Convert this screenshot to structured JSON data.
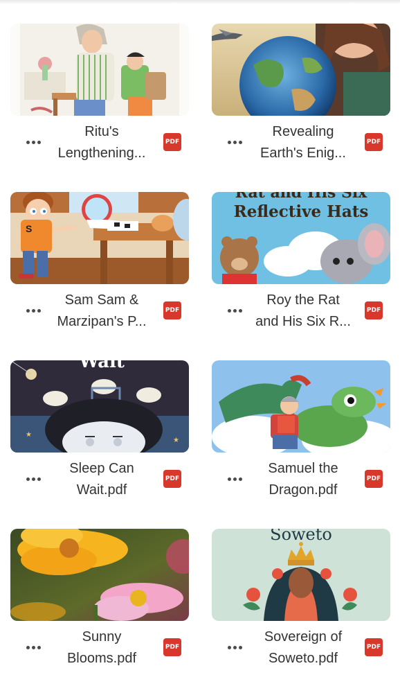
{
  "files": [
    {
      "title": "Ritu's\nLengthening...",
      "badge": "PDF",
      "icon": "more-horizontal-icon"
    },
    {
      "title": "Revealing\nEarth's Enig...",
      "badge": "PDF",
      "icon": "more-horizontal-icon"
    },
    {
      "title": "Sam Sam &\nMarzipan's P...",
      "badge": "PDF",
      "icon": "more-horizontal-icon"
    },
    {
      "title": "Roy the Rat\nand His Six R...",
      "badge": "PDF",
      "thumb_text": "Reflective Hats",
      "thumb_text_top": "Rat and His Six",
      "icon": "more-horizontal-icon"
    },
    {
      "title": "Sleep Can\nWait.pdf",
      "badge": "PDF",
      "thumb_text": "Wait",
      "icon": "more-horizontal-icon"
    },
    {
      "title": "Samuel the\nDragon.pdf",
      "badge": "PDF",
      "icon": "more-horizontal-icon"
    },
    {
      "title": "Sunny\nBlooms.pdf",
      "badge": "PDF",
      "icon": "more-horizontal-icon"
    },
    {
      "title": "Sovereign of\nSoweto.pdf",
      "badge": "PDF",
      "thumb_text": "Soweto",
      "icon": "more-horizontal-icon"
    }
  ],
  "colors": {
    "pdf_badge": "#d8382c",
    "text": "#333333"
  }
}
